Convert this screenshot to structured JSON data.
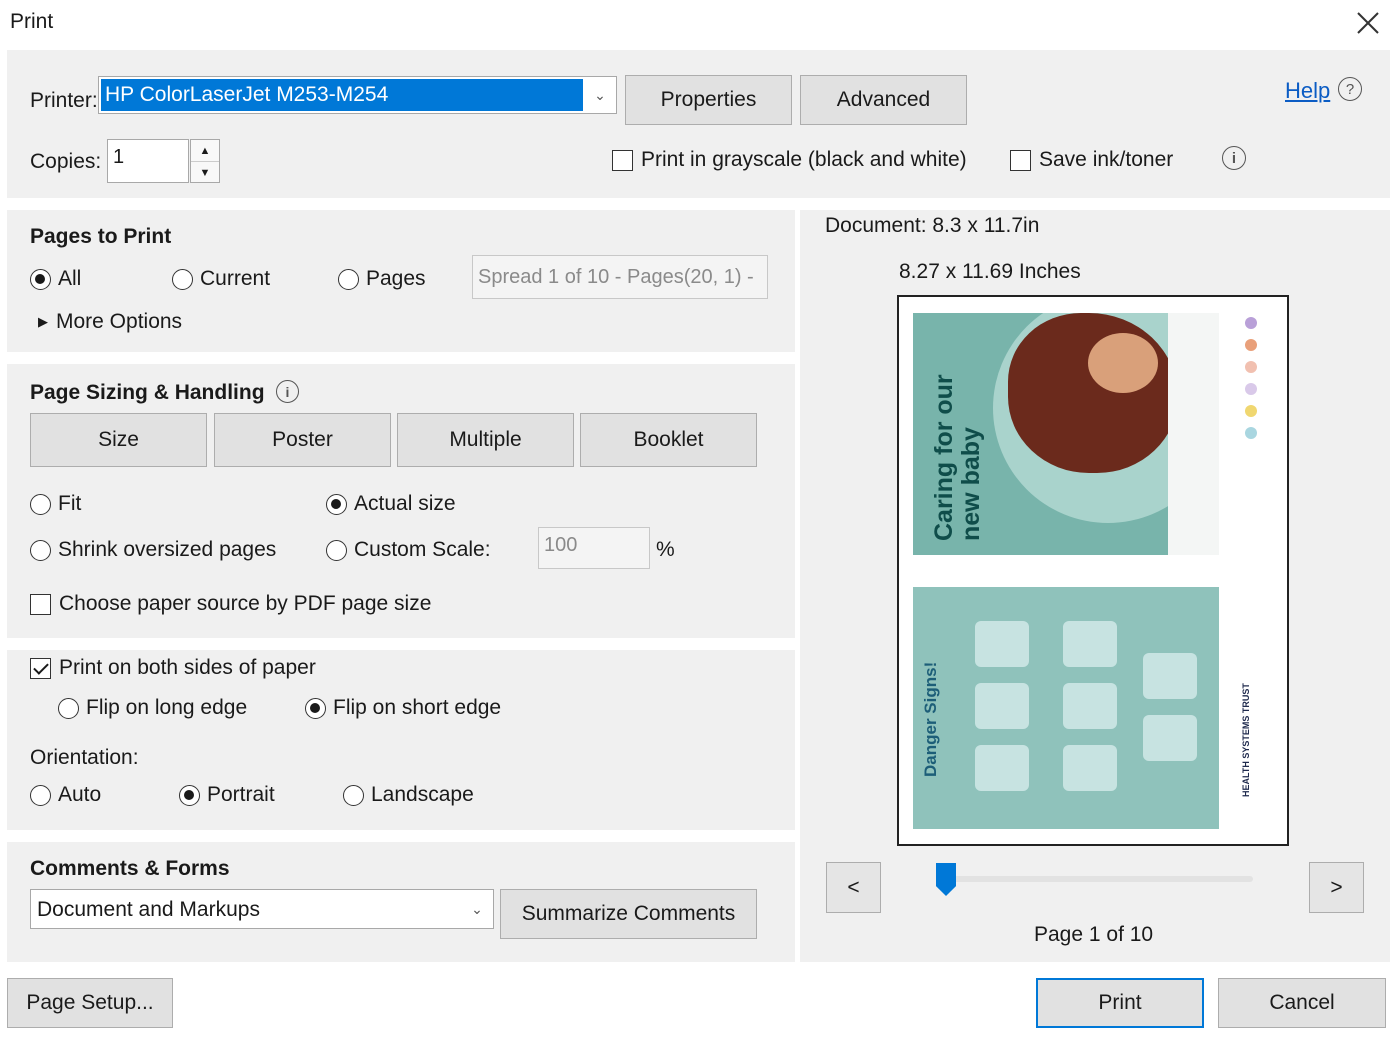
{
  "window": {
    "title": "Print"
  },
  "printer": {
    "label": "Printer:",
    "value": "HP ColorLaserJet M253-M254",
    "properties": "Properties",
    "advanced": "Advanced",
    "help": "Help"
  },
  "copies": {
    "label": "Copies:",
    "value": "1",
    "grayscale": "Print in grayscale (black and white)",
    "save_ink": "Save ink/toner"
  },
  "pages_to_print": {
    "title": "Pages to Print",
    "all": "All",
    "current": "Current",
    "pages": "Pages",
    "pages_value": "Spread 1 of 10 - Pages(20, 1) -",
    "more_options": "More Options"
  },
  "sizing": {
    "title": "Page Sizing & Handling",
    "tabs": [
      "Size",
      "Poster",
      "Multiple",
      "Booklet"
    ],
    "fit": "Fit",
    "actual_size": "Actual size",
    "shrink": "Shrink oversized pages",
    "custom_scale": "Custom Scale:",
    "scale_value": "100",
    "percent": "%",
    "paper_source": "Choose paper source by PDF page size"
  },
  "duplex": {
    "both_sides": "Print on both sides of paper",
    "long_edge": "Flip on long edge",
    "short_edge": "Flip on short edge"
  },
  "orientation": {
    "label": "Orientation:",
    "auto": "Auto",
    "portrait": "Portrait",
    "landscape": "Landscape"
  },
  "comments": {
    "title": "Comments & Forms",
    "value": "Document and Markups",
    "summarize": "Summarize Comments"
  },
  "preview": {
    "document": "Document: 8.3 x 11.7in",
    "dimensions": "8.27 x 11.69 Inches",
    "page_top_title_line1": "Caring for our",
    "page_top_title_line2": "new baby",
    "page_bottom_title": "Danger Signs!",
    "page_bottom_logo": "HEALTH SYSTEMS TRUST",
    "prev": "<",
    "next": ">",
    "page_indicator": "Page 1 of 10",
    "slider_position": 0.0
  },
  "footer": {
    "page_setup": "Page Setup...",
    "print": "Print",
    "cancel": "Cancel"
  },
  "colors": {
    "accent": "#0078d7",
    "help_link": "#0b5cc4",
    "preview_teal": "#6fa9a0"
  }
}
